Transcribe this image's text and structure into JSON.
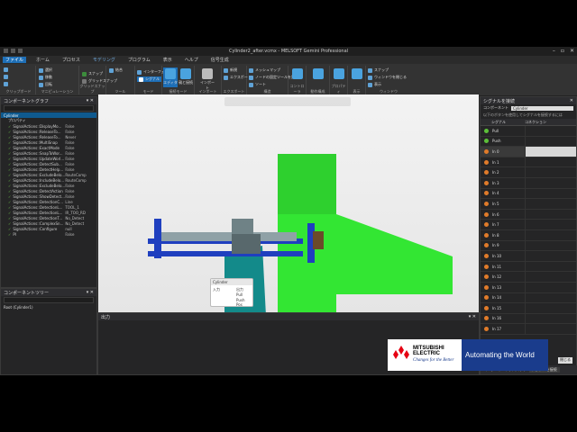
{
  "window": {
    "title": "Cylinder2_after.vcmx - MELSOFT Gemini Professional"
  },
  "menu": [
    "ファイル",
    "ホーム",
    "プロセス",
    "モデリング",
    "プログラム",
    "表示",
    "ヘルプ",
    "信号生成"
  ],
  "ribbon": {
    "groups": [
      "クリップボード",
      "マニピュレーション",
      "グリッドスナップ",
      "ツール",
      "モード",
      "接続モード",
      "インポート",
      "エクスポート",
      "構造",
      "コントローラ",
      "動作構成",
      "プロパティ",
      "表示",
      "ウィンドウ"
    ],
    "buttons": {
      "interface": "インターフェース",
      "signal": "シグナル",
      "editor": "エディタ",
      "parent": "親と接続",
      "mesh": "メッシュマップ",
      "new": "新規",
      "import": "インポート",
      "export": "エクスポート",
      "fixed_parent": "ノードの固定ツールを許可",
      "sort": "ソート",
      "close_window": "ウィンドウを閉じる",
      "display": "表示",
      "snap": "スナップ",
      "join": "結合",
      "grid_snap": "グリッドスナップ",
      "sel": "選択",
      "move": "移動",
      "rotate": "回転"
    }
  },
  "left_panel": {
    "title": "コンポーネントグラフ",
    "root": "Cylinder",
    "props_label": "プロパティ",
    "rows": [
      {
        "name": "SignalActions::DisplayMo...",
        "value": "False"
      },
      {
        "name": "SignalActions::ReleaseTo...",
        "value": "False"
      },
      {
        "name": "SignalActions::ReleaseTo...",
        "value": "Never"
      },
      {
        "name": "SignalActions::MultiSnap",
        "value": "False"
      },
      {
        "name": "SignalActions::ExactMode",
        "value": "False"
      },
      {
        "name": "SignalActions::SnapToWor...",
        "value": "False"
      },
      {
        "name": "SignalActions::UpdateWorl...",
        "value": "False"
      },
      {
        "name": "SignalActions::DetectSub...",
        "value": "False"
      },
      {
        "name": "SignalActions::DetectHelp...",
        "value": "False"
      },
      {
        "name": "SignalActions::ExcludeBelo...",
        "value": "RouteComp"
      },
      {
        "name": "SignalActions::IncludeBelo...",
        "value": "RouteComp"
      },
      {
        "name": "SignalActions::ExcludeBelo...",
        "value": "False"
      },
      {
        "name": "SignalActions::DetectAction",
        "value": "False"
      },
      {
        "name": "SignalActions::ShowDetect...",
        "value": "False"
      },
      {
        "name": "SignalActions::DetectionC...",
        "value": "Line"
      },
      {
        "name": "SignalActions::DetectionL...",
        "value": "TOOL_1"
      },
      {
        "name": "SignalActions::DetectionL...",
        "value": "IR_TOO_RD"
      },
      {
        "name": "SignalActions::DetectionT...",
        "value": "No_Detect"
      },
      {
        "name": "SignalActions::ComplexSn...",
        "value": "No_Detect"
      },
      {
        "name": "SignalActions::Configure",
        "value": "null"
      },
      {
        "name": "PI",
        "value": "False"
      }
    ],
    "bottom_title": "コンポーネントツリー",
    "bottom_root": "Root (Cylinder1)"
  },
  "viewport": {
    "label": "TOOL1_2H",
    "mini_panel": {
      "title": "Cylinder",
      "inputs": [
        "入力"
      ],
      "outputs": [
        "出力",
        "Pull",
        "Push",
        "Pos"
      ]
    },
    "nav": [
      "T",
      "L",
      "R",
      "F"
    ]
  },
  "output_panel": {
    "title": "出力"
  },
  "right_panel": {
    "title": "シグナルを接続",
    "component_label": "コンポーネント",
    "component_value": "Cylinder",
    "hint": "以下のボタンを使用してシグナルを接続するには",
    "col_signal": "シグナル",
    "col_connection": "コネクション",
    "signals": [
      "Pull",
      "Push",
      "In 0",
      "In 1",
      "In 2",
      "In 3",
      "In 4",
      "In 5",
      "In 6",
      "In 7",
      "In 8",
      "In 9",
      "In 10",
      "In 11",
      "In 12",
      "In 13",
      "In 14",
      "In 15",
      "In 16",
      "In 17"
    ],
    "close_btn": "閉じる",
    "tab1": "コンポーネントプロパティ",
    "tab2": "シグナルを接続"
  },
  "logo": {
    "brand_line1": "MITSUBISHI",
    "brand_line2": "ELECTRIC",
    "tagline": "Changes for the Better",
    "slogan": "Automating the World"
  },
  "colors": {
    "accent": "#1e6fb7",
    "logo_red": "#e60012",
    "logo_blue": "#1a3c8c",
    "green_part": "#33e633",
    "teal_part": "#138a8a",
    "frame_blue": "#1f3fbf"
  }
}
